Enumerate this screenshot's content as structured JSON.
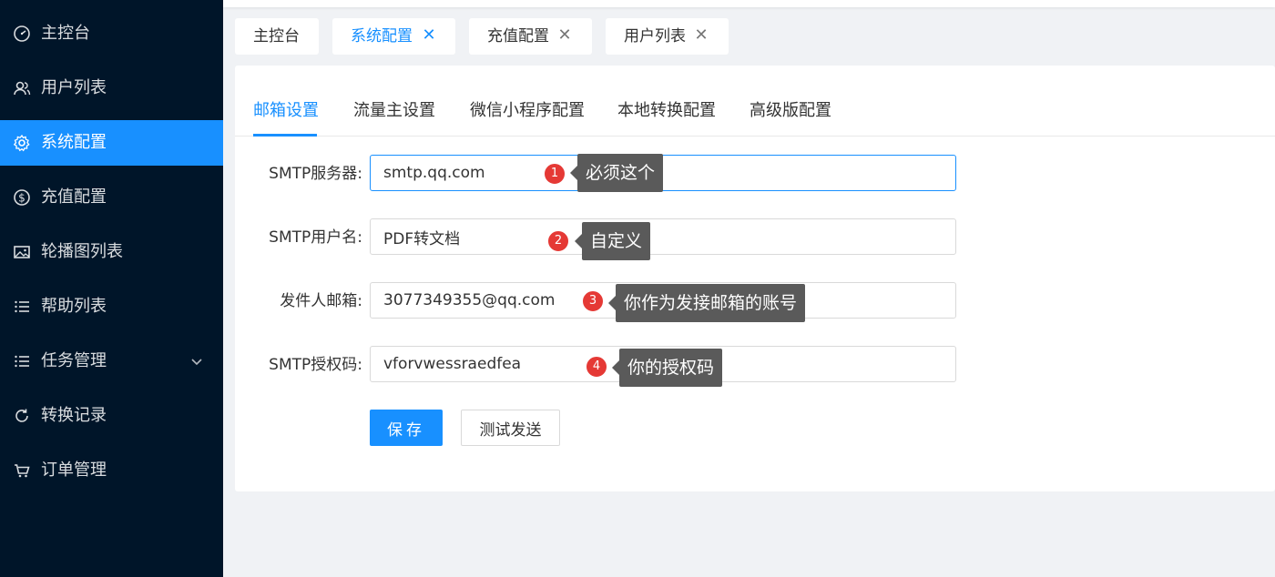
{
  "sidebar": {
    "items": [
      {
        "label": "主控台",
        "icon": "dashboard-icon"
      },
      {
        "label": "用户列表",
        "icon": "users-icon"
      },
      {
        "label": "系统配置",
        "icon": "gear-icon",
        "active": true
      },
      {
        "label": "充值配置",
        "icon": "dollar-icon"
      },
      {
        "label": "轮播图列表",
        "icon": "image-icon"
      },
      {
        "label": "帮助列表",
        "icon": "list-icon"
      },
      {
        "label": "任务管理",
        "icon": "list-icon",
        "expandable": true
      },
      {
        "label": "转换记录",
        "icon": "refresh-icon"
      },
      {
        "label": "订单管理",
        "icon": "cart-icon"
      }
    ]
  },
  "tabs": [
    {
      "label": "主控台",
      "closable": false
    },
    {
      "label": "系统配置",
      "closable": true,
      "active": true
    },
    {
      "label": "充值配置",
      "closable": true
    },
    {
      "label": "用户列表",
      "closable": true
    }
  ],
  "tab_close_glyph": "✕",
  "subtabs": [
    {
      "label": "邮箱设置",
      "active": true
    },
    {
      "label": "流量主设置"
    },
    {
      "label": "微信小程序配置"
    },
    {
      "label": "本地转换配置"
    },
    {
      "label": "高级版配置"
    }
  ],
  "form": {
    "fields": [
      {
        "label": "SMTP服务器:",
        "value": "smtp.qq.com",
        "badge": "1",
        "tip": "必须这个"
      },
      {
        "label": "SMTP用户名:",
        "value": "PDF转文档",
        "badge": "2",
        "tip": "自定义"
      },
      {
        "label": "发件人邮箱:",
        "value": "3077349355@qq.com",
        "badge": "3",
        "tip": "你作为发接邮箱的账号"
      },
      {
        "label": "SMTP授权码:",
        "value": "vforvwessraedfea",
        "badge": "4",
        "tip": "你的授权码"
      }
    ],
    "save_label": "保存",
    "test_label": "测试发送"
  },
  "colors": {
    "sidebar_bg": "#001529",
    "accent": "#1890ff",
    "badge": "#e53935",
    "tooltip_bg": "#5a5a5a"
  }
}
